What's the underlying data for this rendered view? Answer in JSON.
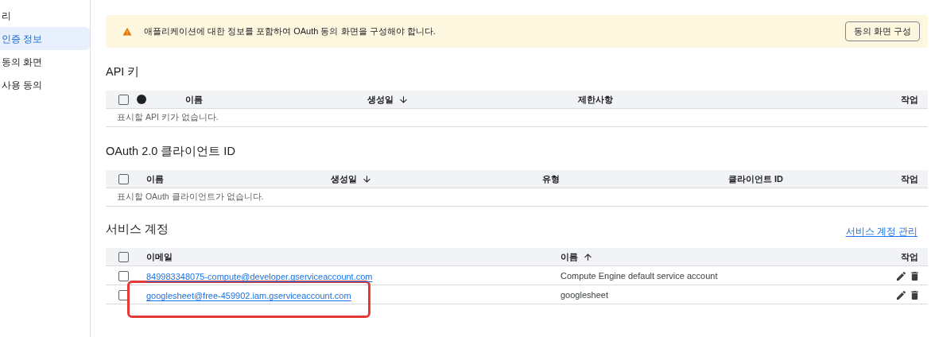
{
  "sidebar": {
    "items": [
      {
        "label": "리",
        "selected": false
      },
      {
        "label": "인증 정보",
        "selected": true
      },
      {
        "label": "동의 화면",
        "selected": false
      },
      {
        "label": "사용 동의",
        "selected": false
      }
    ]
  },
  "banner": {
    "message": "애플리케이션에 대한 정보를 포함하여 OAuth 동의 화면을 구성해야 합니다.",
    "button": "동의 화면 구성"
  },
  "tables": [
    {
      "title": "API 키",
      "header_checked": false,
      "columns": [
        {
          "kind": "status"
        },
        {
          "kind": "text",
          "label": "이름",
          "sorted": false
        },
        {
          "kind": "text",
          "label": "생성일",
          "sorted": true,
          "ascending": false
        },
        {
          "kind": "text",
          "label": "제한사항",
          "sorted": false
        },
        {
          "kind": "text",
          "label": "작업",
          "sorted": false
        }
      ],
      "empty_message": "표시할 API 키가 없습니다."
    },
    {
      "title": "OAuth 2.0 클라이언트 ID",
      "header_checked": false,
      "columns": [
        {
          "kind": "text",
          "label": "이름",
          "sorted": false
        },
        {
          "kind": "text",
          "label": "생성일",
          "sorted": true,
          "ascending": false
        },
        {
          "kind": "text",
          "label": "유형",
          "sorted": false
        },
        {
          "kind": "text",
          "label": "클라이언트 ID",
          "sorted": false
        },
        {
          "kind": "text",
          "label": "작업",
          "sorted": false
        }
      ],
      "empty_message": "표시할 OAuth 클라이언트가 없습니다."
    },
    {
      "title": "서비스 계정",
      "link": "서비스 계정 관리",
      "header_checked": false,
      "columns": [
        {
          "kind": "text",
          "label": "이메일",
          "sorted": false
        },
        {
          "kind": "text",
          "label": "이름",
          "sorted": true,
          "ascending": true
        },
        {
          "kind": "text",
          "label": "작업",
          "sorted": false
        }
      ],
      "rows": [
        {
          "checked": false,
          "highlighted": false,
          "email": "849983348075-compute@developer.gserviceaccount.com",
          "name": "Compute Engine default service account"
        },
        {
          "checked": false,
          "highlighted": true,
          "email": "googlesheet@free-459902.iam.gserviceaccount.com",
          "name": "googlesheet"
        }
      ]
    }
  ]
}
